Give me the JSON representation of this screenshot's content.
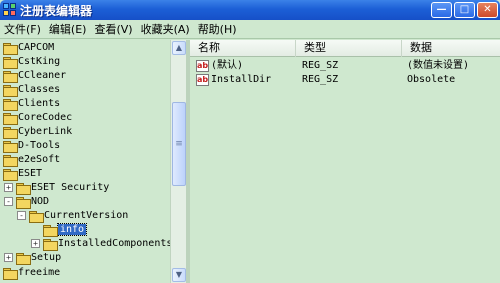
{
  "window": {
    "title": "注册表编辑器",
    "minimize_glyph": "—",
    "maximize_glyph": "□",
    "close_glyph": "✕"
  },
  "menu": [
    {
      "label": "文件(F)"
    },
    {
      "label": "编辑(E)"
    },
    {
      "label": "查看(V)"
    },
    {
      "label": "收藏夹(A)"
    },
    {
      "label": "帮助(H)"
    }
  ],
  "tree": {
    "items": [
      {
        "label": "CAPCOM"
      },
      {
        "label": "CstKing"
      },
      {
        "label": "CCleaner"
      },
      {
        "label": "Classes"
      },
      {
        "label": "Clients"
      },
      {
        "label": "CoreCodec"
      },
      {
        "label": "CyberLink"
      },
      {
        "label": "D-Tools"
      },
      {
        "label": "e2eSoft"
      },
      {
        "label": "ESET"
      },
      {
        "label": "ESET Security",
        "expander": "+"
      },
      {
        "label": "NOD",
        "expander": "-"
      },
      {
        "label": "CurrentVersion",
        "expander": "-"
      },
      {
        "label": "info",
        "selected": true
      },
      {
        "label": "InstalledComponents",
        "expander": "+"
      },
      {
        "label": "Setup",
        "expander": "+"
      },
      {
        "label": "freeime"
      }
    ]
  },
  "scrollbar": {
    "up_glyph": "▲",
    "down_glyph": "▼",
    "grip_glyph": "≡"
  },
  "list": {
    "columns": [
      "名称",
      "类型",
      "数据"
    ],
    "rows": [
      {
        "icon": "ab",
        "name": "(默认)",
        "type": "REG_SZ",
        "data": "(数值未设置)"
      },
      {
        "icon": "ab",
        "name": "InstallDir",
        "type": "REG_SZ",
        "data": "Obsolete"
      }
    ]
  }
}
